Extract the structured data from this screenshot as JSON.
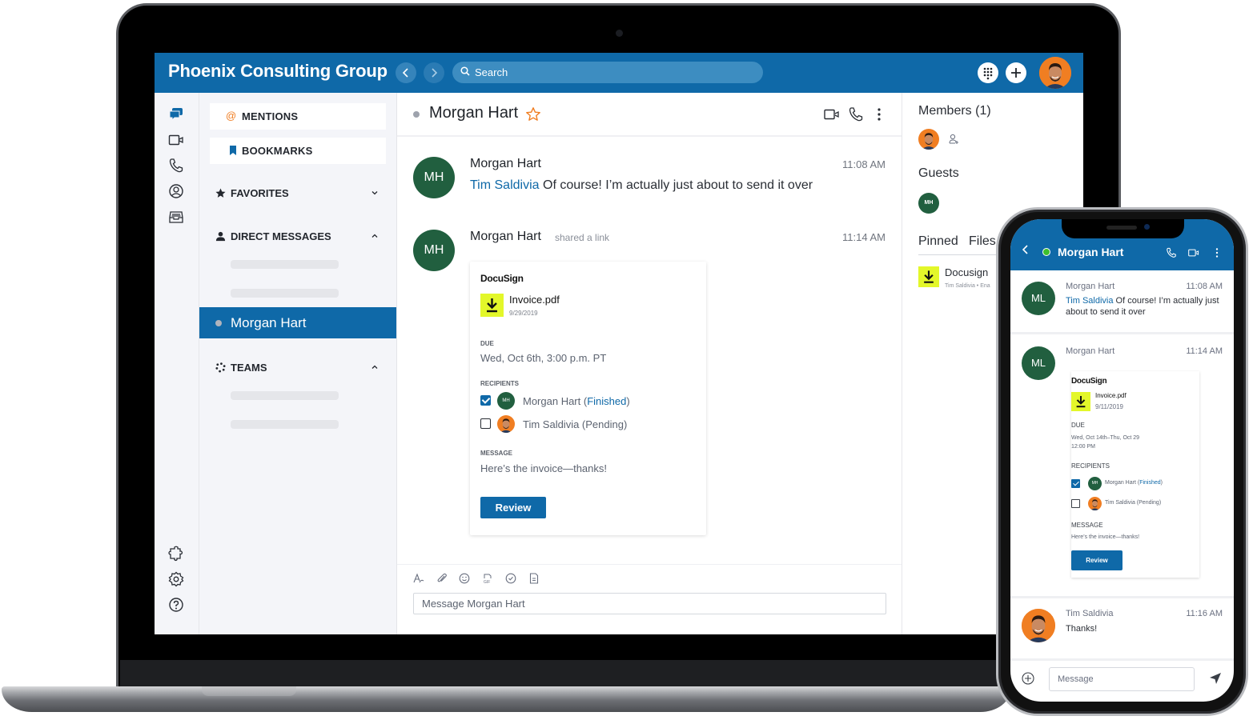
{
  "colors": {
    "brand_blue": "#0f69a8",
    "avatar_green": "#215f3f",
    "accent_orange": "#f07e22",
    "docusign_yellow": "#e3f72a",
    "online_green": "#3fbf2e"
  },
  "desktop": {
    "header": {
      "title": "Phoenix Consulting Group",
      "back_icon": "chevron-left-icon",
      "forward_icon": "chevron-right-icon",
      "search_placeholder": "Search",
      "dialpad_icon": "dialpad-icon",
      "add_icon": "plus-icon",
      "user_avatar": "user-avatar-photo"
    },
    "rail": {
      "top_icons": [
        "chat-icon",
        "video-icon",
        "phone-icon",
        "contacts-icon",
        "inbox-icon"
      ],
      "bottom_icons": [
        "integrations-icon",
        "settings-icon",
        "help-icon"
      ]
    },
    "sidebar": {
      "mentions_label": "MENTIONS",
      "bookmarks_label": "BOOKMARKS",
      "favorites_label": "FAVORITES",
      "direct_messages_label": "DIRECT MESSAGES",
      "active_dm": "Morgan Hart",
      "teams_label": "TEAMS"
    },
    "chat": {
      "title": "Morgan Hart",
      "messages": [
        {
          "avatar_initials": "MH",
          "author": "Morgan Hart",
          "time": "11:08 AM",
          "mention": "Tim Saldivia",
          "text": " Of course! I’m actually just about to send it over"
        },
        {
          "avatar_initials": "MH",
          "author": "Morgan Hart",
          "meta": "shared a link",
          "time": "11:14 AM"
        }
      ],
      "docusign_card": {
        "brand": "DocuSign",
        "file_name": "Invoice.pdf",
        "file_date": "9/29/2019",
        "due_label": "DUE",
        "due_value": "Wed, Oct 6th, 3:00 p.m. PT",
        "recipients_label": "RECIPIENTS",
        "recipients": [
          {
            "initials": "MH",
            "name": "Morgan Hart (",
            "status": "Finished",
            "close": ")",
            "checked": true
          },
          {
            "name": "Tim Saldivia (Pending)",
            "checked": false
          }
        ],
        "message_label": "MESSAGE",
        "message_value": "Here’s the invoice—thanks!",
        "review_label": "Review"
      },
      "composer": {
        "tools": [
          "format-icon",
          "attach-icon",
          "emoji-icon",
          "gif-icon",
          "task-icon",
          "note-icon"
        ],
        "placeholder": "Message Morgan Hart"
      }
    },
    "right_panel": {
      "members_title": "Members (1)",
      "guests_title": "Guests",
      "guest_initials": "MH",
      "tabs": [
        "Pinned",
        "Files"
      ],
      "pinned_item": {
        "name": "Docusign",
        "meta": "Tim Saldivia • Ena"
      }
    }
  },
  "mobile": {
    "header": {
      "title": "Morgan Hart"
    },
    "messages": [
      {
        "avatar_initials": "ML",
        "author": "Morgan Hart",
        "time": "11:08 AM",
        "mention": "Tim Saldivia",
        "text": " Of course! I’m actually just about to send it over"
      },
      {
        "avatar_initials": "ML",
        "author": "Morgan Hart",
        "time": "11:14 AM"
      },
      {
        "author": "Tim Saldivia",
        "time": "11:16 AM",
        "text": "Thanks!"
      }
    ],
    "docusign_card": {
      "brand": "DocuSign",
      "file_name": "Invoice.pdf",
      "file_date": "9/11/2019",
      "due_label": "DUE",
      "due_line1": "Wed, Oct 14th–Thu, Oct 29",
      "due_line2": "12:00 PM",
      "recipients_label": "RECIPIENTS",
      "recipients": [
        {
          "initials": "MH",
          "name": "Morgan Hart (",
          "status": "Finished",
          "close": ")",
          "checked": true
        },
        {
          "name": "Tim Saldivia (Pending)",
          "checked": false
        }
      ],
      "message_label": "MESSAGE",
      "message_value": "Here’s the invoice—thanks!",
      "review_label": "Review"
    },
    "composer": {
      "placeholder": "Message"
    }
  }
}
